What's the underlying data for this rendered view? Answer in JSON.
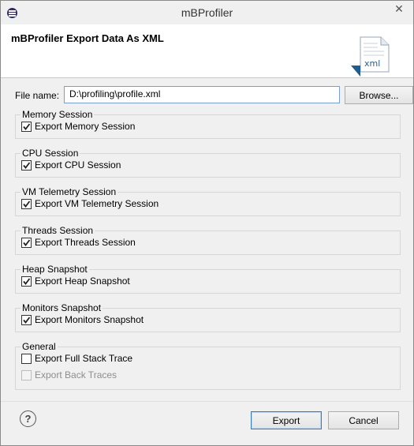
{
  "window": {
    "title": "mBProfiler",
    "close_glyph": "✕"
  },
  "header": {
    "title": "mBProfiler Export Data As XML",
    "icon": "xml-file-icon",
    "icon_text": "xml"
  },
  "file": {
    "label": "File name:",
    "value": "D:\\profiling\\profile.xml",
    "browse_label": "Browse..."
  },
  "groups": [
    {
      "label": "Memory Session",
      "options": [
        {
          "label": "Export Memory Session",
          "checked": true,
          "enabled": true
        }
      ]
    },
    {
      "label": "CPU Session",
      "options": [
        {
          "label": "Export CPU Session",
          "checked": true,
          "enabled": true
        }
      ]
    },
    {
      "label": "VM Telemetry Session",
      "options": [
        {
          "label": "Export VM Telemetry Session",
          "checked": true,
          "enabled": true
        }
      ]
    },
    {
      "label": "Threads Session",
      "options": [
        {
          "label": "Export Threads Session",
          "checked": true,
          "enabled": true
        }
      ]
    },
    {
      "label": "Heap Snapshot",
      "options": [
        {
          "label": "Export Heap Snapshot",
          "checked": true,
          "enabled": true
        }
      ]
    },
    {
      "label": "Monitors Snapshot",
      "options": [
        {
          "label": "Export Monitors Snapshot",
          "checked": true,
          "enabled": true
        }
      ]
    },
    {
      "label": "General",
      "options": [
        {
          "label": "Export Full Stack Trace",
          "checked": false,
          "enabled": true
        },
        {
          "label": "Export Back Traces",
          "checked": false,
          "enabled": false
        }
      ]
    }
  ],
  "footer": {
    "help_glyph": "?",
    "export_label": "Export",
    "cancel_label": "Cancel"
  }
}
